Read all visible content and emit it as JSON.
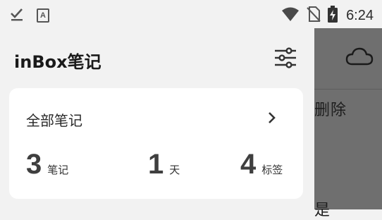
{
  "status_bar": {
    "time": "6:24",
    "icons": [
      "check-download-icon",
      "a-notification-icon",
      "wifi-icon",
      "no-sim-icon",
      "battery-charging-icon"
    ]
  },
  "drawer": {
    "app_title": "inBox笔记",
    "card": {
      "title": "全部笔记",
      "stats": [
        {
          "value": "3",
          "unit": "笔记"
        },
        {
          "value": "1",
          "unit": "天"
        },
        {
          "value": "4",
          "unit": "标签"
        }
      ]
    }
  },
  "background_content": {
    "delete_label": "删除",
    "partial_char": "是"
  },
  "colors": {
    "surface": "#f2f2f2",
    "card": "#ffffff",
    "scrim": "#6f6f6f",
    "text_dark": "#1a1a1a"
  }
}
